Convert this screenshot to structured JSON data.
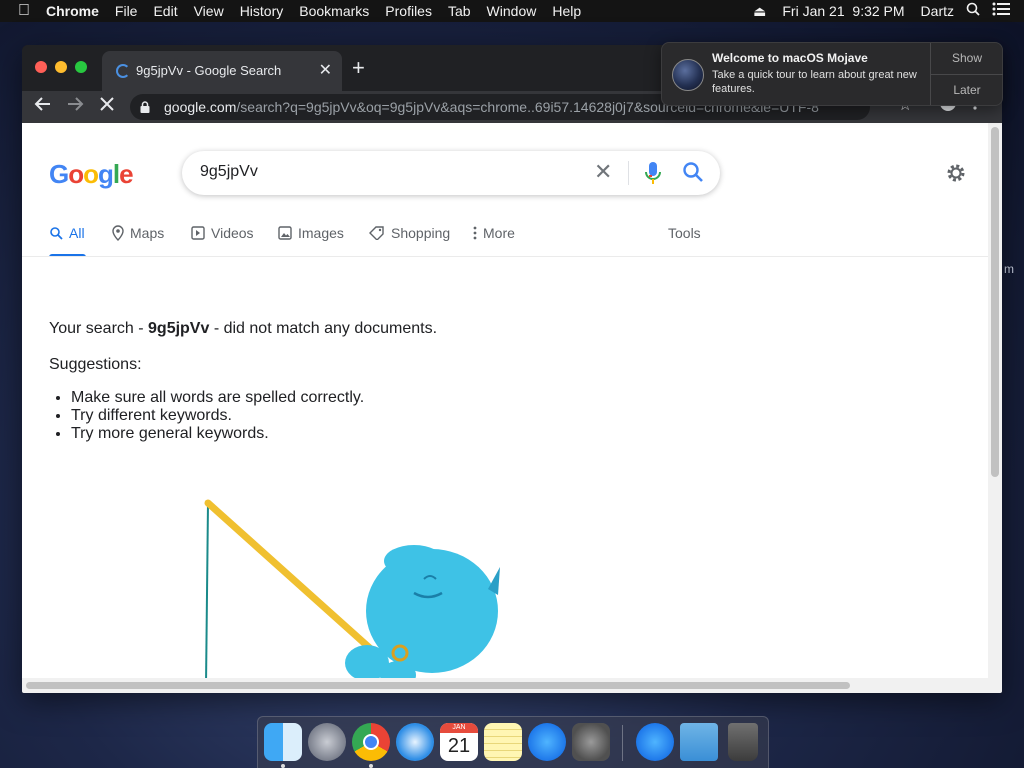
{
  "menubar": {
    "app_name": "Chrome",
    "menus": [
      "File",
      "Edit",
      "View",
      "History",
      "Bookmarks",
      "Profiles",
      "Tab",
      "Window",
      "Help"
    ],
    "datetime": "Fri Jan 21  9:32 PM",
    "user": "Dartz"
  },
  "browser": {
    "tab_title": "9g5jpVv - Google Search",
    "url_host": "google.com",
    "url_path": "/search?q=9g5jpVv&oq=9g5jpVv&aqs=chrome..69i57.14628j0j7&sourceid=chrome&ie=UTF-8"
  },
  "google": {
    "search_value": "9g5jpVv",
    "tabs": [
      "All",
      "Maps",
      "Videos",
      "Images",
      "Shopping",
      "More"
    ],
    "tools_label": "Tools",
    "no_results_prefix": "Your search - ",
    "query_bold": "9g5jpVv",
    "no_results_suffix": " - did not match any documents.",
    "suggestions_label": "Suggestions:",
    "suggestions": [
      "Make sure all words are spelled correctly.",
      "Try different keywords.",
      "Try more general keywords."
    ],
    "accent_color": "#1a73e8"
  },
  "notification": {
    "title": "Welcome to macOS Mojave",
    "body": "Take a quick tour to learn about great new features.",
    "show_label": "Show",
    "later_label": "Later"
  },
  "dock": {
    "items": [
      "finder-icon",
      "launchpad-icon",
      "chrome-icon",
      "safari-icon",
      "calendar-icon",
      "notes-icon",
      "app-store-icon",
      "system-preferences-icon",
      "app-store-download-icon",
      "downloads-folder-icon",
      "trash-icon"
    ],
    "calendar_month": "JAN",
    "calendar_day": "21"
  }
}
